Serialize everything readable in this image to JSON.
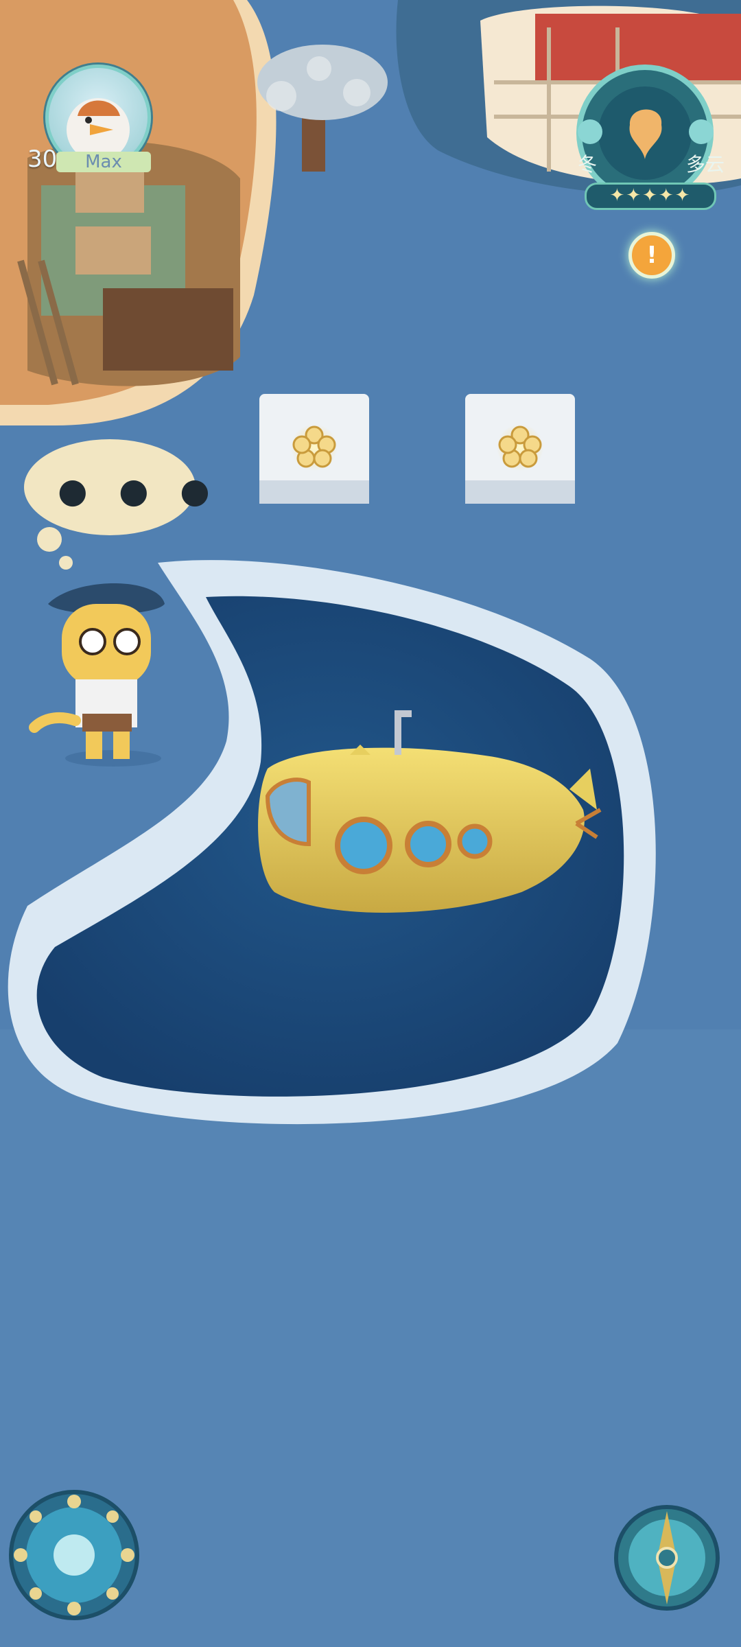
{
  "player": {
    "level": "30",
    "name": "Max",
    "avatar_icon": "duck-avatar-icon"
  },
  "weather": {
    "season": "冬",
    "condition": "多云",
    "stars": "✦✦✦✦✦",
    "alert": "!"
  },
  "npc": {
    "thought": "● ● ●"
  },
  "buttons": {
    "left_icon": "magic-circle-icon",
    "right_icon": "compass-icon"
  },
  "colors": {
    "water": "#1d4f82",
    "ground": "#4f7bad",
    "ice": "#dbe8f3",
    "submarine": "#e7cf5f",
    "accent": "#7fcfc8"
  }
}
